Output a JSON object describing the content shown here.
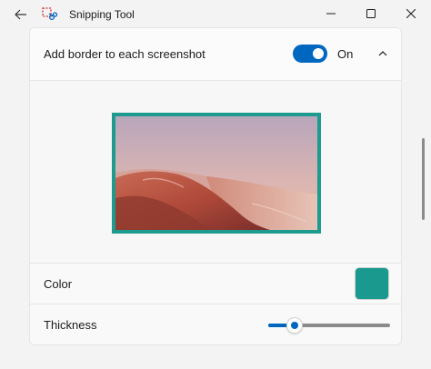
{
  "window": {
    "title": "Snipping Tool"
  },
  "icons": {
    "back": "back-arrow-icon",
    "app": "snipping-tool-icon",
    "minimize": "minimize-icon",
    "maximize": "maximize-icon",
    "close": "close-icon",
    "collapse": "chevron-up-icon"
  },
  "border_setting": {
    "label": "Add border to each screenshot",
    "toggle_state": "On",
    "enabled": true
  },
  "color_setting": {
    "label": "Color",
    "value": "#1a9a8f"
  },
  "thickness_setting": {
    "label": "Thickness",
    "level": 0.22
  },
  "colors": {
    "accent": "#0067c0",
    "border": "#1e9a8f"
  }
}
